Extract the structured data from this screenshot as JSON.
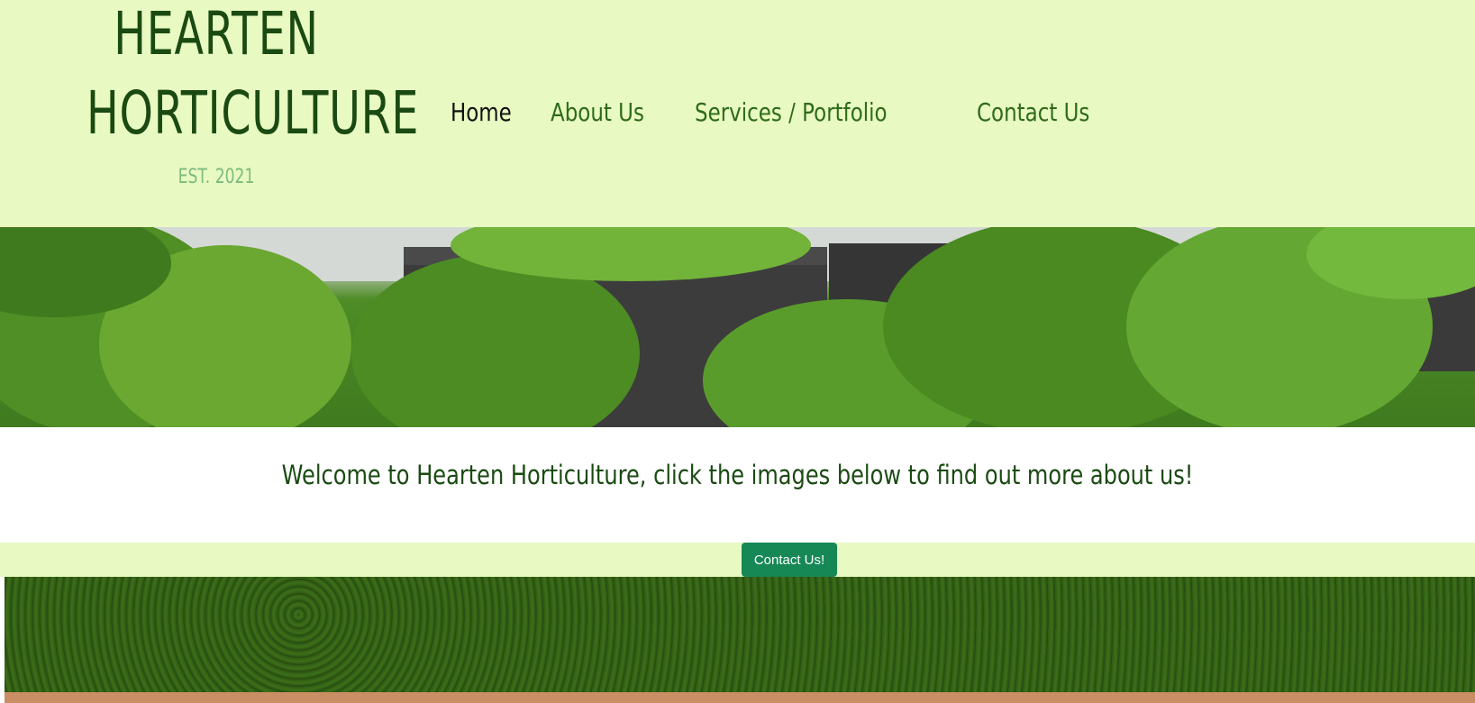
{
  "brand": {
    "title_line1": "HEARTEN",
    "title_line2": "HORTICULTURE",
    "established": "EST. 2021"
  },
  "nav": {
    "items": [
      {
        "label": "Home",
        "active": true
      },
      {
        "label": "About Us",
        "active": false
      },
      {
        "label": "Services / Portfolio",
        "active": false
      },
      {
        "label": "Contact Us",
        "active": false
      }
    ]
  },
  "welcome": {
    "text": "Welcome to Hearten Horticulture, click the images below to find out more about us!"
  },
  "cta": {
    "label": "Contact Us!"
  },
  "colors": {
    "header_bg": "#e8fac2",
    "brand_text": "#1a4a12",
    "nav_text": "#2e6b18",
    "nav_active": "#111111",
    "est_text": "#7cba7e",
    "button_bg": "#168856"
  }
}
